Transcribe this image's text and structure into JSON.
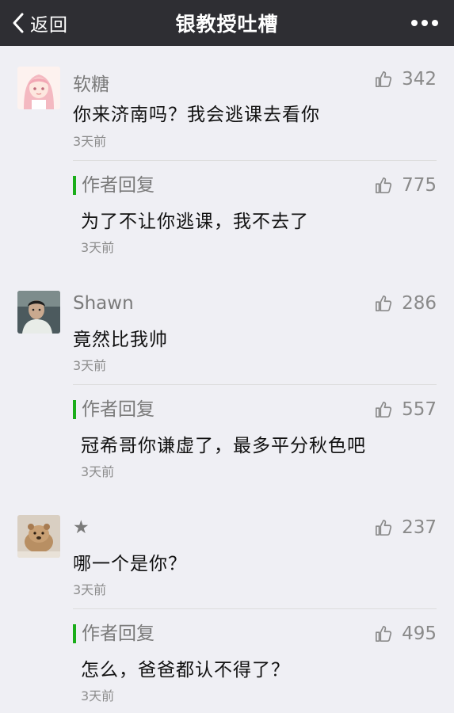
{
  "nav": {
    "back_label": "返回",
    "title": "银教授吐槽"
  },
  "comments": [
    {
      "nickname": "软糖",
      "likes": "342",
      "content": "你来济南吗？我会逃课去看你",
      "time": "3天前",
      "reply": {
        "label": "作者回复",
        "likes": "775",
        "content": "为了不让你逃课，我不去了",
        "time": "3天前"
      }
    },
    {
      "nickname": "Shawn",
      "likes": "286",
      "content": "竟然比我帅",
      "time": "3天前",
      "reply": {
        "label": "作者回复",
        "likes": "557",
        "content": "冠希哥你谦虚了，最多平分秋色吧",
        "time": "3天前"
      }
    },
    {
      "nickname": "★",
      "likes": "237",
      "content": "哪一个是你？",
      "time": "3天前",
      "reply": {
        "label": "作者回复",
        "likes": "495",
        "content": "怎么，爸爸都认不得了？",
        "time": "3天前"
      }
    }
  ],
  "colors": {
    "navbar": "#2e2e33",
    "background": "#efeff4",
    "reply_accent": "#1aad19"
  },
  "icons": {
    "back": "chevron-left-icon",
    "more": "more-dots-icon",
    "like": "thumbs-up-icon"
  }
}
